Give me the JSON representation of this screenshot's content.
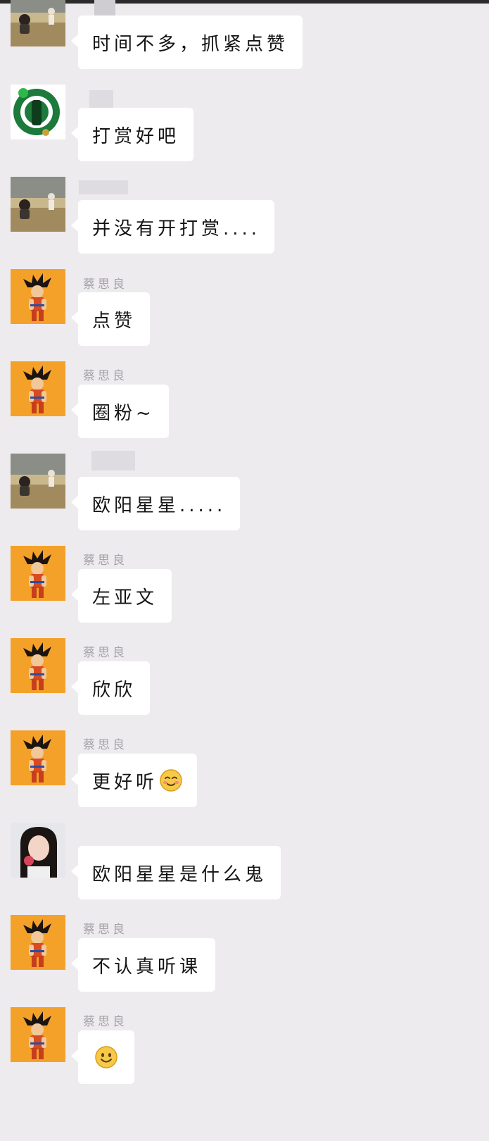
{
  "colors": {
    "background": "#eeebef",
    "bubble": "#ffffff",
    "sender_name": "#a6a3a8",
    "avatar_goku_bg": "#f4a12a"
  },
  "messages": [
    {
      "avatar": "photo-avatar-icon",
      "sender": "",
      "text": "时间不多，抓紧点赞"
    },
    {
      "avatar": "green-lantern-avatar-icon",
      "sender": "",
      "text": "打赏好吧"
    },
    {
      "avatar": "photo-avatar-icon",
      "sender": "",
      "text": "并没有开打赏...."
    },
    {
      "avatar": "goku-avatar-icon",
      "sender": "蔡思良",
      "text": "点赞"
    },
    {
      "avatar": "goku-avatar-icon",
      "sender": "蔡思良",
      "text": "圈粉~"
    },
    {
      "avatar": "photo-avatar-icon",
      "sender": "",
      "text": "欧阳星星....."
    },
    {
      "avatar": "goku-avatar-icon",
      "sender": "蔡思良",
      "text": "左亚文"
    },
    {
      "avatar": "goku-avatar-icon",
      "sender": "蔡思良",
      "text": "欣欣"
    },
    {
      "avatar": "goku-avatar-icon",
      "sender": "蔡思良",
      "text": "更好听",
      "emoji": "smiling-blush-emoji-icon"
    },
    {
      "avatar": "girl-photo-avatar-icon",
      "sender": "",
      "text": "欧阳星星是什么鬼"
    },
    {
      "avatar": "goku-avatar-icon",
      "sender": "蔡思良",
      "text": "不认真听课"
    },
    {
      "avatar": "goku-avatar-icon",
      "sender": "蔡思良",
      "text": "",
      "emoji": "smile-emoji-icon"
    }
  ]
}
